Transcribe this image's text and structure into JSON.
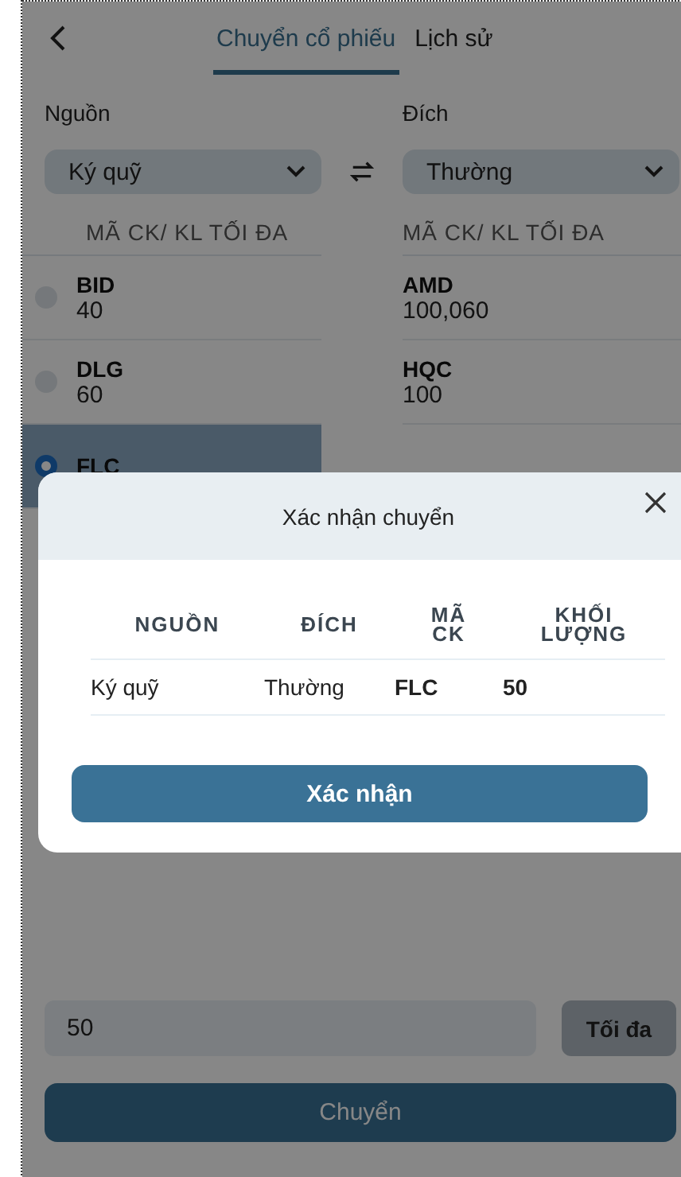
{
  "header": {
    "tabs": [
      {
        "label": "Chuyển cổ phiếu",
        "selected": true
      },
      {
        "label": "Lịch sử",
        "selected": false
      }
    ]
  },
  "source": {
    "label": "Nguồn",
    "value": "Ký quỹ",
    "column_header": "MÃ CK/ KL TỐI ĐA",
    "items": [
      {
        "symbol": "BID",
        "quantity": "40",
        "selected": false
      },
      {
        "symbol": "DLG",
        "quantity": "60",
        "selected": false
      },
      {
        "symbol": "FLC",
        "selected": true
      }
    ]
  },
  "destination": {
    "label": "Đích",
    "value": "Thường",
    "column_header": "MÃ CK/ KL TỐI ĐA",
    "items": [
      {
        "symbol": "AMD",
        "quantity": "100,060"
      },
      {
        "symbol": "HQC",
        "quantity": "100"
      }
    ]
  },
  "quantity_field": {
    "value": "50"
  },
  "max_button": "Tối đa",
  "transfer_button": "Chuyển",
  "dialog": {
    "title": "Xác nhận chuyển",
    "columns": [
      "NGUỒN",
      "ĐÍCH",
      "MÃ CK",
      "KHỐI LƯỢNG"
    ],
    "row": [
      "Ký quỹ",
      "Thường",
      "FLC",
      "50"
    ],
    "confirm_button": "Xác nhận"
  }
}
